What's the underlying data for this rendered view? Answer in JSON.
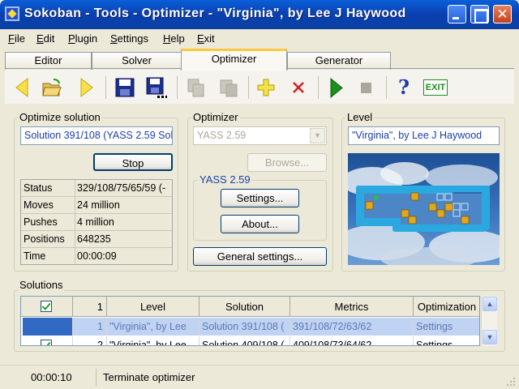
{
  "window": {
    "title": "Sokoban - Tools - Optimizer - \"Virginia\", by Lee J Haywood"
  },
  "menu": [
    {
      "label": "File",
      "hotkey": "F",
      "rest": "ile"
    },
    {
      "label": "Edit",
      "hotkey": "E",
      "rest": "dit"
    },
    {
      "label": "Plugin",
      "hotkey": "P",
      "rest": "lugin"
    },
    {
      "label": "Settings",
      "hotkey": "S",
      "rest": "ettings"
    },
    {
      "label": "Help",
      "hotkey": "H",
      "rest": "elp"
    },
    {
      "label": "Exit",
      "hotkey": "E",
      "rest": "xit"
    }
  ],
  "tabs": {
    "editor": "Editor",
    "solver": "Solver",
    "optimizer": "Optimizer",
    "generator": "Generator"
  },
  "toolbar": {
    "icons": [
      "arrow-left-icon",
      "open-folder-icon",
      "arrow-right-icon",
      "save-icon",
      "save-as-icon",
      "copy-icon",
      "paste-icon",
      "add-icon",
      "delete-icon",
      "play-icon",
      "stop-icon",
      "help-icon",
      "exit-icon"
    ],
    "exit_label": "EXIT",
    "help_label": "?"
  },
  "optimize_solution": {
    "label": "Optimize solution",
    "solution_name": "Solution 391/108 (YASS 2.59 Sol",
    "stop_button": "Stop",
    "stats": [
      {
        "key": "Status",
        "value": "329/108/75/65/59  (-"
      },
      {
        "key": "Moves",
        "value": "24 million"
      },
      {
        "key": "Pushes",
        "value": "4 million"
      },
      {
        "key": "Positions",
        "value": "648235"
      },
      {
        "key": "Time",
        "value": "00:00:09"
      }
    ]
  },
  "optimizer": {
    "label": "Optimizer",
    "selected": "YASS 2.59",
    "browse_button": "Browse...",
    "plugin_group_label": "YASS 2.59",
    "settings_button": "Settings...",
    "about_button": "About...",
    "general_settings_button": "General settings..."
  },
  "level": {
    "label": "Level",
    "name": "\"Virginia\", by Lee J Haywood"
  },
  "solutions": {
    "label": "Solutions",
    "header_count": "1",
    "columns": [
      "Level",
      "Solution",
      "Metrics",
      "Optimization"
    ],
    "rows": [
      {
        "num": "1",
        "level": "\"Virginia\", by Lee",
        "solution": "Solution 391/108 (",
        "metrics": "391/108/72/63/62",
        "optimization": "Settings"
      },
      {
        "num": "2",
        "level": "\"Virginia\", by Lee",
        "solution": "Solution 409/108 (",
        "metrics": "409/108/73/64/62",
        "optimization": "Settings"
      }
    ]
  },
  "status": {
    "time": "00:00:10",
    "message": "Terminate optimizer"
  },
  "colors": {
    "title_bar": "#0a4fc8",
    "selection": "#316ac5",
    "tab_highlight": "#ffc83d"
  }
}
